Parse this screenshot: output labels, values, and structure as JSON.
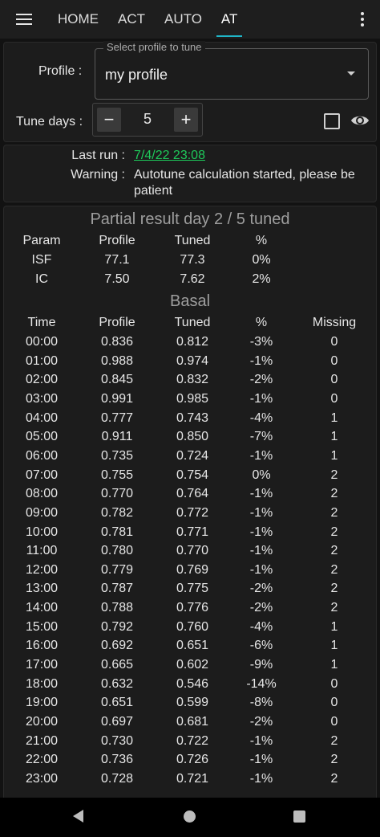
{
  "tabs": [
    "HOME",
    "ACT",
    "AUTO",
    "AT"
  ],
  "active_tab": "AT",
  "profile": {
    "label": "Profile :",
    "legend": "Select profile to tune",
    "value": "my profile"
  },
  "tune": {
    "label": "Tune days :",
    "value": "5",
    "minus": "−",
    "plus": "+"
  },
  "run": {
    "last_run_label": "Last run :",
    "last_run_value": "7/4/22 23:08",
    "warning_label": "Warning :",
    "warning_line1": "Autotune calculation started, please be",
    "warning_line2": "patient"
  },
  "results": {
    "title": "Partial result day 2 / 5 tuned",
    "param_headers": [
      "Param",
      "Profile",
      "Tuned",
      "%"
    ],
    "params": [
      [
        "ISF",
        "77.1",
        "77.3",
        "0%"
      ],
      [
        "IC",
        "7.50",
        "7.62",
        "2%"
      ]
    ],
    "basal_title": "Basal",
    "basal_headers": [
      "Time",
      "Profile",
      "Tuned",
      "%",
      "Missing"
    ],
    "basal": [
      [
        "00:00",
        "0.836",
        "0.812",
        "-3%",
        "0"
      ],
      [
        "01:00",
        "0.988",
        "0.974",
        "-1%",
        "0"
      ],
      [
        "02:00",
        "0.845",
        "0.832",
        "-2%",
        "0"
      ],
      [
        "03:00",
        "0.991",
        "0.985",
        "-1%",
        "0"
      ],
      [
        "04:00",
        "0.777",
        "0.743",
        "-4%",
        "1"
      ],
      [
        "05:00",
        "0.911",
        "0.850",
        "-7%",
        "1"
      ],
      [
        "06:00",
        "0.735",
        "0.724",
        "-1%",
        "1"
      ],
      [
        "07:00",
        "0.755",
        "0.754",
        "0%",
        "2"
      ],
      [
        "08:00",
        "0.770",
        "0.764",
        "-1%",
        "2"
      ],
      [
        "09:00",
        "0.782",
        "0.772",
        "-1%",
        "2"
      ],
      [
        "10:00",
        "0.781",
        "0.771",
        "-1%",
        "2"
      ],
      [
        "11:00",
        "0.780",
        "0.770",
        "-1%",
        "2"
      ],
      [
        "12:00",
        "0.779",
        "0.769",
        "-1%",
        "2"
      ],
      [
        "13:00",
        "0.787",
        "0.775",
        "-2%",
        "2"
      ],
      [
        "14:00",
        "0.788",
        "0.776",
        "-2%",
        "2"
      ],
      [
        "15:00",
        "0.792",
        "0.760",
        "-4%",
        "1"
      ],
      [
        "16:00",
        "0.692",
        "0.651",
        "-6%",
        "1"
      ],
      [
        "17:00",
        "0.665",
        "0.602",
        "-9%",
        "1"
      ],
      [
        "18:00",
        "0.632",
        "0.546",
        "-14%",
        "0"
      ],
      [
        "19:00",
        "0.651",
        "0.599",
        "-8%",
        "0"
      ],
      [
        "20:00",
        "0.697",
        "0.681",
        "-2%",
        "0"
      ],
      [
        "21:00",
        "0.730",
        "0.722",
        "-1%",
        "2"
      ],
      [
        "22:00",
        "0.736",
        "0.726",
        "-1%",
        "2"
      ],
      [
        "23:00",
        "0.728",
        "0.721",
        "-1%",
        "2"
      ]
    ]
  },
  "colors": {
    "accent": "#1fb5c7",
    "link": "#1ec95a",
    "background": "#121212"
  },
  "icons": {
    "menu": "hamburger-icon",
    "overflow": "more-vert-icon",
    "dropdown": "arrow-drop-down-icon",
    "visibility": "eye-icon",
    "nav_back": "back-triangle-icon",
    "nav_home": "home-circle-icon",
    "nav_recent": "recents-square-icon"
  }
}
